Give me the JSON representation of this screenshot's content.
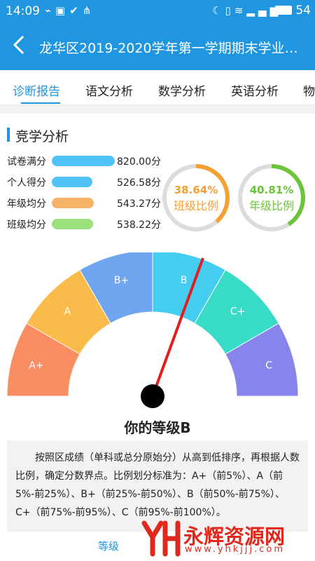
{
  "status_bar": {
    "time": "14:09",
    "left_icons": [
      "usb-icon",
      "image-icon",
      "check-circle-icon",
      "share-icon"
    ],
    "right_icons": [
      "moon-icon",
      "vibrate-icon",
      "wifi-icon",
      "signal-icon"
    ],
    "battery": "54"
  },
  "app_bar": {
    "title": "龙华区2019-2020学年第一学期期末学业质..."
  },
  "tabs": [
    {
      "label": "诊断报告",
      "active": true
    },
    {
      "label": "语文分析",
      "active": false
    },
    {
      "label": "数学分析",
      "active": false
    },
    {
      "label": "英语分析",
      "active": false
    },
    {
      "label": "物",
      "active": false
    }
  ],
  "section": {
    "title": "竞学分析"
  },
  "stats": [
    {
      "label": "试卷满分",
      "value": "820.00分",
      "amount": 820.0,
      "color": "#4fc3f7"
    },
    {
      "label": "个人得分",
      "value": "526.58分",
      "amount": 526.58,
      "color": "#4fc3f7"
    },
    {
      "label": "年级均分",
      "value": "543.27分",
      "amount": 543.27,
      "color": "#f7b267"
    },
    {
      "label": "班级均分",
      "value": "538.22分",
      "amount": 538.22,
      "color": "#9be07a"
    }
  ],
  "rings": [
    {
      "percent_text": "38.64%",
      "caption": "班级比例",
      "fraction": 0.3864,
      "color": "#f5a033"
    },
    {
      "percent_text": "40.81%",
      "caption": "年级比例",
      "fraction": 0.4081,
      "color": "#6cc43a"
    }
  ],
  "gauge": {
    "segments": [
      {
        "label": "A+",
        "color": "#fb8d62"
      },
      {
        "label": "A",
        "color": "#fbbb4a"
      },
      {
        "label": "B+",
        "color": "#6fa6ef"
      },
      {
        "label": "B",
        "color": "#45cdf1"
      },
      {
        "label": "C+",
        "color": "#37dbc6"
      },
      {
        "label": "C",
        "color": "#8785ec"
      }
    ],
    "needle_color": "#e02020"
  },
  "grade_text": "你的等级B",
  "description": "按照区成绩（单科或总分原始分）从高到低排序，再根据人数比例，确定分数界点。比例划分标准为：A+（前5%）、A（前5%-前25%）、B+（前25%-前50%）、B（前50%-前75%）、C+（前75%-前95%）、C（前95%-前100%）。",
  "bottom_tab": "等级",
  "watermark": {
    "name": "永辉资源网",
    "url": "www.yhkjjj.com",
    "logo_text": "YH"
  }
}
